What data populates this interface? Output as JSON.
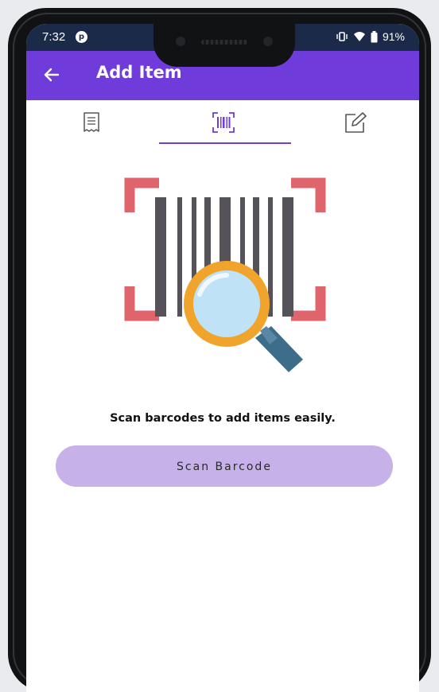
{
  "status_bar": {
    "time": "7:32",
    "notification_icon": "app-notification-icon",
    "battery_percent": "91%",
    "icons": [
      "vibrate-icon",
      "wifi-icon",
      "battery-icon"
    ]
  },
  "app_bar": {
    "back_icon": "arrow-left-icon",
    "title": "Add Item"
  },
  "tabs": [
    {
      "icon": "receipt-icon",
      "selected": false
    },
    {
      "icon": "barcode-scan-icon",
      "selected": true
    },
    {
      "icon": "edit-icon",
      "selected": false
    }
  ],
  "illustration": {
    "icon": "barcode-magnifier-illustration",
    "colors": {
      "corners": "#e0646c",
      "bars": "#55525a",
      "lens_rim": "#f0a42c",
      "lens_glass": "#bfe2f7",
      "handle": "#3d6d8a"
    }
  },
  "main": {
    "message": "Scan barcodes to add items easily.",
    "scan_button_label": "Scan Barcode"
  },
  "colors": {
    "accent": "#6f3bdb",
    "button_bg": "#c6b1e9",
    "status_bar_bg": "#1c2a4a"
  }
}
